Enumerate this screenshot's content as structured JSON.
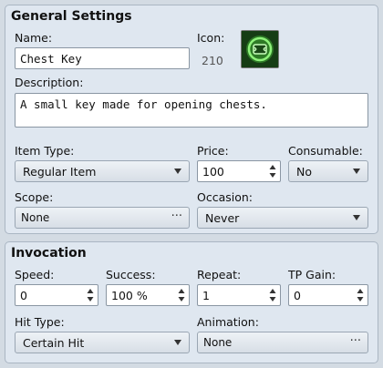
{
  "general": {
    "title": "General Settings",
    "name_label": "Name:",
    "name_value": "Chest Key",
    "icon_label": "Icon:",
    "icon_index": "210",
    "description_label": "Description:",
    "description_value": "A small key made for opening chests.",
    "item_type_label": "Item Type:",
    "item_type_value": "Regular Item",
    "price_label": "Price:",
    "price_value": "100",
    "consumable_label": "Consumable:",
    "consumable_value": "No",
    "scope_label": "Scope:",
    "scope_value": "None",
    "occasion_label": "Occasion:",
    "occasion_value": "Never"
  },
  "invocation": {
    "title": "Invocation",
    "speed_label": "Speed:",
    "speed_value": "0",
    "success_label": "Success:",
    "success_value": "100 %",
    "repeat_label": "Repeat:",
    "repeat_value": "1",
    "tp_gain_label": "TP Gain:",
    "tp_gain_value": "0",
    "hit_type_label": "Hit Type:",
    "hit_type_value": "Certain Hit",
    "animation_label": "Animation:",
    "animation_value": "None"
  },
  "icons": {
    "item_icon": "key-emblem-icon",
    "spin_arrows": "up-down-arrows-icon",
    "dropdown": "chevron-down-icon",
    "picker": "ellipsis-icon"
  },
  "colors": {
    "panel_bg": "#dfe7f0",
    "window_bg": "#d3dbe3",
    "icon_bg": "#1c4a1a",
    "icon_glow": "#6fe35a"
  }
}
